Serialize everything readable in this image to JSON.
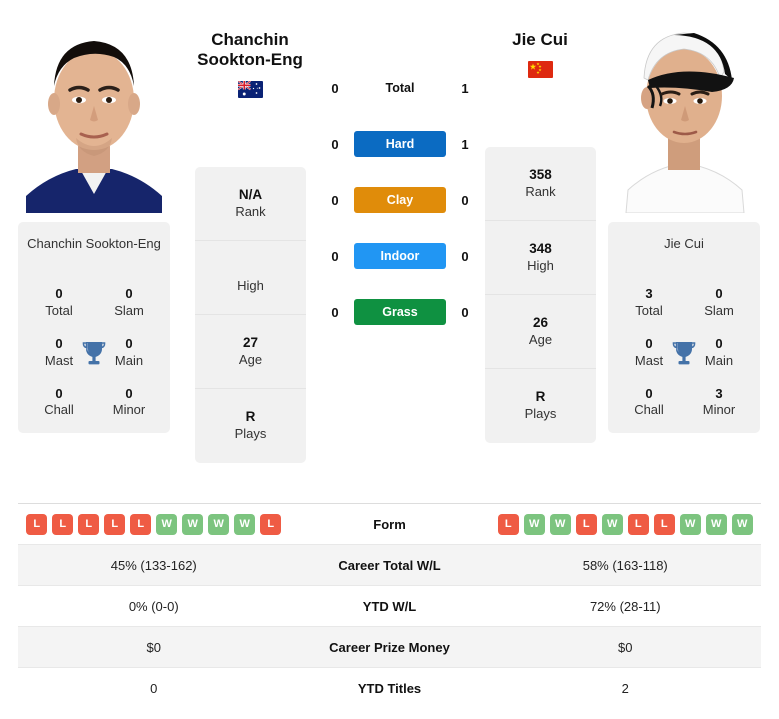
{
  "players": {
    "left": {
      "name": "Chanchin Sookton-Eng",
      "name_line1": "Chanchin",
      "name_line2": "Sookton-Eng",
      "flag": "australia-flag",
      "card_name": "Chanchin Sookton-Eng",
      "info": [
        {
          "value": "N/A",
          "label": "Rank"
        },
        {
          "value": "",
          "label": "High"
        },
        {
          "value": "27",
          "label": "Age"
        },
        {
          "value": "R",
          "label": "Plays"
        }
      ],
      "titles": [
        {
          "value": "0",
          "label": "Total"
        },
        {
          "value": "0",
          "label": "Slam"
        },
        {
          "value": "0",
          "label": "Mast"
        },
        {
          "value": "0",
          "label": "Main"
        },
        {
          "value": "0",
          "label": "Chall"
        },
        {
          "value": "0",
          "label": "Minor"
        }
      ],
      "form": [
        "L",
        "L",
        "L",
        "L",
        "L",
        "W",
        "W",
        "W",
        "W",
        "L"
      ],
      "career_total_wl": "45% (133-162)",
      "ytd_wl": "0% (0-0)",
      "career_prize_money": "$0",
      "ytd_titles": "0"
    },
    "right": {
      "name": "Jie Cui",
      "name_line1": "Jie Cui",
      "name_line2": "",
      "flag": "china-flag",
      "card_name": "Jie Cui",
      "info": [
        {
          "value": "358",
          "label": "Rank"
        },
        {
          "value": "348",
          "label": "High"
        },
        {
          "value": "26",
          "label": "Age"
        },
        {
          "value": "R",
          "label": "Plays"
        }
      ],
      "titles": [
        {
          "value": "3",
          "label": "Total"
        },
        {
          "value": "0",
          "label": "Slam"
        },
        {
          "value": "0",
          "label": "Mast"
        },
        {
          "value": "0",
          "label": "Main"
        },
        {
          "value": "0",
          "label": "Chall"
        },
        {
          "value": "3",
          "label": "Minor"
        }
      ],
      "form": [
        "L",
        "W",
        "W",
        "L",
        "W",
        "L",
        "L",
        "W",
        "W",
        "W"
      ],
      "career_total_wl": "58% (163-118)",
      "ytd_wl": "72% (28-11)",
      "career_prize_money": "$0",
      "ytd_titles": "2"
    }
  },
  "surfaces": [
    {
      "label": "Total",
      "left": "0",
      "right": "1",
      "color": "transparent",
      "plain": true
    },
    {
      "label": "Hard",
      "left": "0",
      "right": "1",
      "color": "#0b6bc2",
      "plain": false
    },
    {
      "label": "Clay",
      "left": "0",
      "right": "0",
      "color": "#e08c0a",
      "plain": false
    },
    {
      "label": "Indoor",
      "left": "0",
      "right": "0",
      "color": "#2196f3",
      "plain": false
    },
    {
      "label": "Grass",
      "left": "0",
      "right": "0",
      "color": "#0f9141",
      "plain": false
    }
  ],
  "stats_rows": [
    {
      "label": "Form",
      "key": "form",
      "type": "form",
      "shaded": false
    },
    {
      "label": "Career Total W/L",
      "key": "career_total_wl",
      "type": "text",
      "shaded": true
    },
    {
      "label": "YTD W/L",
      "key": "ytd_wl",
      "type": "text",
      "shaded": false
    },
    {
      "label": "Career Prize Money",
      "key": "career_prize_money",
      "type": "text",
      "shaded": true
    },
    {
      "label": "YTD Titles",
      "key": "ytd_titles",
      "type": "text",
      "shaded": false
    }
  ],
  "colors": {
    "hard": "#0b6bc2",
    "clay": "#e08c0a",
    "indoor": "#2196f3",
    "grass": "#0f9141",
    "win_badge": "#7cc47f",
    "loss_badge": "#ef5b44",
    "trophy": "#4472a8",
    "panel_bg": "#f1f1f1"
  },
  "icons": {
    "trophy": "trophy-icon",
    "left_flag": "australia-flag",
    "right_flag": "china-flag"
  }
}
